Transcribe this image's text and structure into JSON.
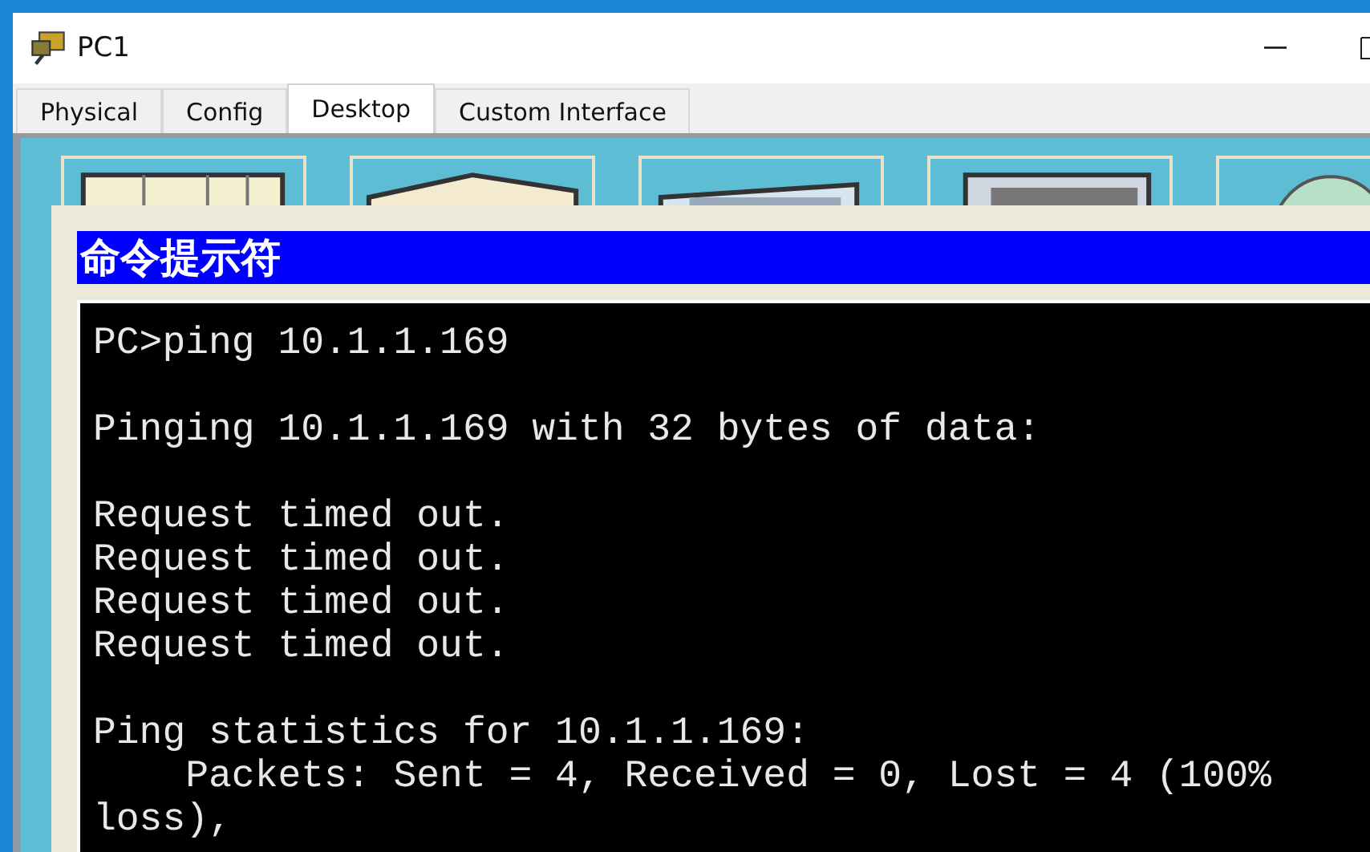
{
  "window": {
    "title": "PC1"
  },
  "tabs": [
    {
      "label": "Physical",
      "selected": false
    },
    {
      "label": "Config",
      "selected": false
    },
    {
      "label": "Desktop",
      "selected": true
    },
    {
      "label": "Custom Interface",
      "selected": false
    }
  ],
  "desktop": {
    "apps": [
      {
        "kind": "window"
      },
      {
        "kind": "box"
      },
      {
        "kind": "monitor"
      },
      {
        "kind": "screen"
      },
      {
        "kind": "globe"
      }
    ]
  },
  "command_prompt": {
    "title": "命令提示符",
    "blocks": [
      [
        "PC>ping 10.1.1.169"
      ],
      [
        "Pinging 10.1.1.169 with 32 bytes of data:"
      ],
      [
        "Request timed out.",
        "Request timed out.",
        "Request timed out.",
        "Request timed out."
      ],
      [
        "Ping statistics for 10.1.1.169:",
        "    Packets: Sent = 4, Received = 0, Lost = 4 (100%",
        "loss),"
      ]
    ]
  }
}
